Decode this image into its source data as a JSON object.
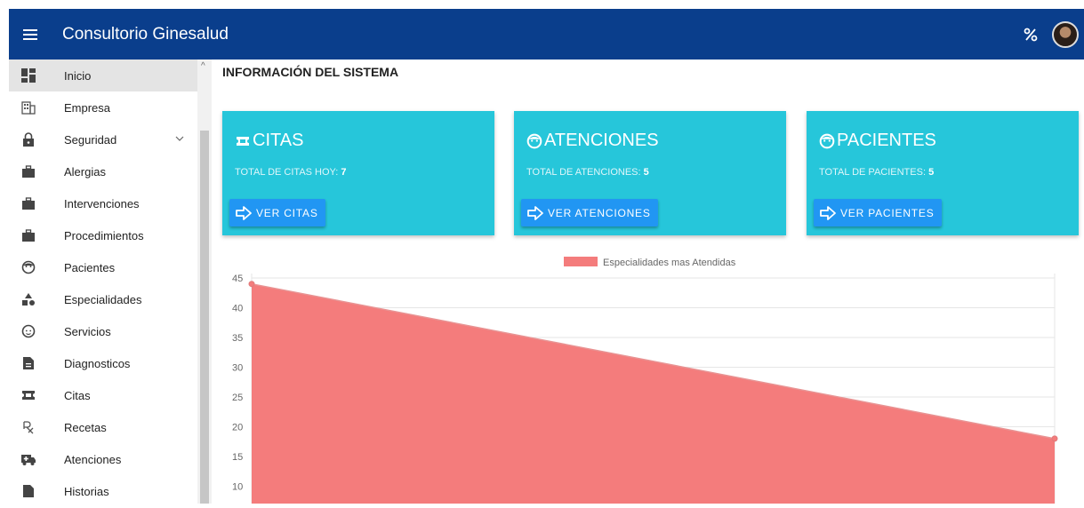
{
  "header": {
    "app_title": "Consultorio Ginesalud",
    "bg_color": "#0a3e8c"
  },
  "sidebar": {
    "items": [
      {
        "label": "Inicio",
        "icon": "dashboard-icon",
        "active": true
      },
      {
        "label": "Empresa",
        "icon": "building-icon"
      },
      {
        "label": "Seguridad",
        "icon": "lock-icon",
        "expandable": true
      },
      {
        "label": "Alergias",
        "icon": "briefcase-icon"
      },
      {
        "label": "Intervenciones",
        "icon": "briefcase-icon"
      },
      {
        "label": "Procedimientos",
        "icon": "briefcase-icon"
      },
      {
        "label": "Pacientes",
        "icon": "face-icon"
      },
      {
        "label": "Especialidades",
        "icon": "shapes-icon"
      },
      {
        "label": "Servicios",
        "icon": "baby-face-icon"
      },
      {
        "label": "Diagnosticos",
        "icon": "document-icon"
      },
      {
        "label": "Citas",
        "icon": "ticket-icon"
      },
      {
        "label": "Recetas",
        "icon": "prescription-icon"
      },
      {
        "label": "Atenciones",
        "icon": "ambulance-icon"
      },
      {
        "label": "Historias",
        "icon": "file-icon"
      }
    ]
  },
  "main": {
    "heading": "INFORMACIÓN DEL SISTEMA",
    "cards": [
      {
        "title": "CITAS",
        "sub_label": "TOTAL DE CITAS HOY:",
        "value": "7",
        "button": "VER CITAS",
        "icon": "ticket-icon"
      },
      {
        "title": "ATENCIONES",
        "sub_label": "TOTAL DE ATENCIONES:",
        "value": "5",
        "button": "VER ATENCIONES",
        "icon": "face-icon"
      },
      {
        "title": "PACIENTES",
        "sub_label": "TOTAL DE PACIENTES:",
        "value": "5",
        "button": "VER PACIENTES",
        "icon": "face-icon"
      }
    ],
    "card_color": "#26c6da",
    "button_color": "#2196f3"
  },
  "chart_data": {
    "type": "area",
    "series": [
      {
        "name": "Especialidades mas Atendidas",
        "values": [
          44,
          18
        ],
        "color": "#f47c7c"
      }
    ],
    "yticks": [
      10,
      15,
      20,
      25,
      30,
      35,
      40,
      45
    ],
    "ylim": [
      10,
      45
    ],
    "grid": true,
    "legend": "top"
  }
}
